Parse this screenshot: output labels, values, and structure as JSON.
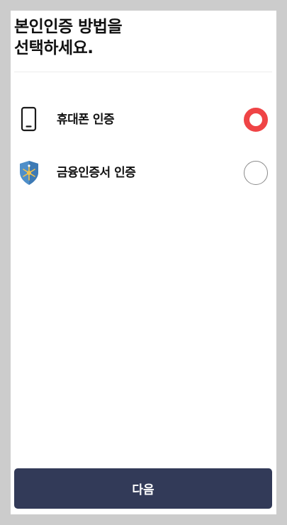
{
  "header": {
    "title_line1": "본인인증 방법을",
    "title_line2": "선택하세요."
  },
  "options": [
    {
      "label": "휴대폰 인증",
      "icon": "smartphone-icon",
      "selected": true
    },
    {
      "label": "금융인증서 인증",
      "icon": "shield-icon",
      "selected": false
    }
  ],
  "footer": {
    "next_label": "다음"
  },
  "colors": {
    "radio_selected": "#ef4446",
    "radio_unselected_border": "#8a8a8a",
    "primary_button": "#323a58",
    "shield_fill": "#4f8fc9",
    "shield_emblem": "#f2c24b"
  }
}
